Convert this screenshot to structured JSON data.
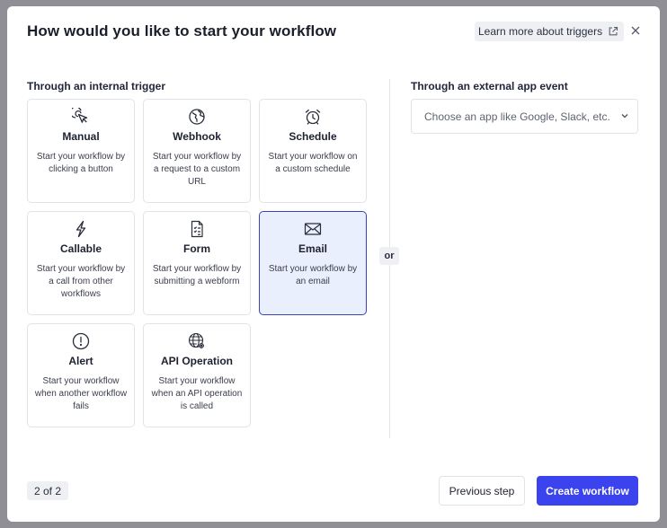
{
  "dialog": {
    "title": "How would you like to start your workflow",
    "learn_more_label": "Learn more about triggers"
  },
  "internal": {
    "label": "Through an internal trigger",
    "triggers": [
      {
        "name": "Manual",
        "icon": "pointer-click-icon",
        "description": "Start your workflow by clicking a button",
        "selected": false
      },
      {
        "name": "Webhook",
        "icon": "globe-icon",
        "description": "Start your workflow by a request to a custom URL",
        "selected": false
      },
      {
        "name": "Schedule",
        "icon": "alarm-clock-icon",
        "description": "Start your workflow on a custom schedule",
        "selected": false
      },
      {
        "name": "Callable",
        "icon": "lightning-icon",
        "description": "Start your workflow by a call from other workflows",
        "selected": false
      },
      {
        "name": "Form",
        "icon": "form-document-icon",
        "description": "Start your workflow by submitting a webform",
        "selected": false
      },
      {
        "name": "Email",
        "icon": "envelope-icon",
        "description": "Start your workflow by an email",
        "selected": true
      },
      {
        "name": "Alert",
        "icon": "alert-circle-icon",
        "description": "Start your workflow when another workflow fails",
        "selected": false
      },
      {
        "name": "API Operation",
        "icon": "api-globe-icon",
        "description": "Start your workflow when an API operation is called",
        "selected": false
      }
    ]
  },
  "separator_label": "or",
  "external": {
    "label": "Through an external app event",
    "select_placeholder": "Choose an app like Google, Slack, etc."
  },
  "footer": {
    "step_indicator": "2 of 2",
    "previous_label": "Previous step",
    "create_label": "Create workflow"
  },
  "colors": {
    "primary": "#3a43ee",
    "selected_bg": "#e9effc",
    "selected_border": "#3a43b8",
    "backdrop": "#8f8f95"
  }
}
